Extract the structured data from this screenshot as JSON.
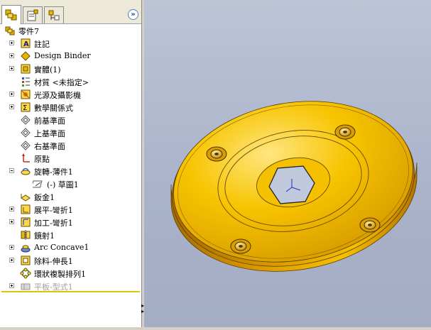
{
  "feature_manager": {
    "tabs": [
      "feature-manager-tab",
      "property-manager-tab",
      "configuration-manager-tab"
    ],
    "expand_glyph": "»",
    "tree": [
      {
        "label": "零件7",
        "icon": "part-icon",
        "expander": "none",
        "indent": 0
      },
      {
        "label": "註記",
        "icon": "annotations-icon",
        "expander": "plus",
        "indent": 1
      },
      {
        "label": "Design Binder",
        "icon": "design-binder-icon",
        "expander": "plus",
        "indent": 1
      },
      {
        "label": "實體(1)",
        "icon": "solid-bodies-icon",
        "expander": "plus",
        "indent": 1
      },
      {
        "label": "材質 <未指定>",
        "icon": "material-icon",
        "expander": "none",
        "indent": 1
      },
      {
        "label": "光源及攝影機",
        "icon": "lights-cameras-icon",
        "expander": "plus",
        "indent": 1
      },
      {
        "label": "數學關係式",
        "icon": "equations-icon",
        "expander": "plus",
        "indent": 1
      },
      {
        "label": "前基準面",
        "icon": "plane-icon",
        "expander": "none",
        "indent": 1
      },
      {
        "label": "上基準面",
        "icon": "plane-icon",
        "expander": "none",
        "indent": 1
      },
      {
        "label": "右基準面",
        "icon": "plane-icon",
        "expander": "none",
        "indent": 1
      },
      {
        "label": "原點",
        "icon": "origin-icon",
        "expander": "none",
        "indent": 1
      },
      {
        "label": "旋轉-薄件1",
        "icon": "revolve-thin-icon",
        "expander": "minus",
        "indent": 1
      },
      {
        "label": "(-) 草圖1",
        "icon": "sketch-icon",
        "expander": "none",
        "indent": 2
      },
      {
        "label": "鈑金1",
        "icon": "sheet-metal-icon",
        "expander": "none",
        "indent": 1
      },
      {
        "label": "展平-彎折1",
        "icon": "flatten-bends-icon",
        "expander": "plus",
        "indent": 1
      },
      {
        "label": "加工-彎折1",
        "icon": "process-bends-icon",
        "expander": "plus",
        "indent": 1
      },
      {
        "label": "鏡射1",
        "icon": "mirror-icon",
        "expander": "none",
        "indent": 1
      },
      {
        "label": "Arc Concave1",
        "icon": "forming-tool-icon",
        "expander": "plus",
        "indent": 1
      },
      {
        "label": "除料-伸長1",
        "icon": "extruded-cut-icon",
        "expander": "plus",
        "indent": 1
      },
      {
        "label": "環狀複製排列1",
        "icon": "circular-pattern-icon",
        "expander": "none",
        "indent": 1
      },
      {
        "label": "平板-型式1",
        "icon": "flat-pattern-icon",
        "expander": "plus",
        "indent": 1,
        "suppressed": true
      }
    ]
  },
  "model": {
    "description_icon": "hex-hole-flange-icon",
    "face_color": "#f2b600",
    "origin_axes": [
      "triad-icon"
    ]
  }
}
